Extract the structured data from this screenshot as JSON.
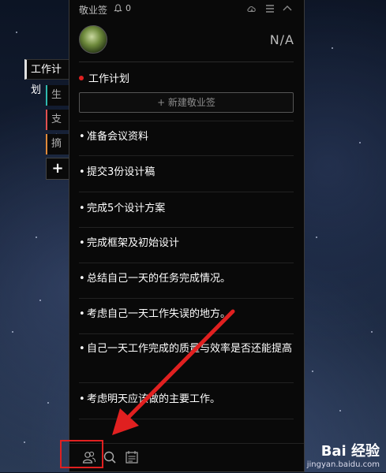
{
  "app": {
    "title": "敬业签",
    "notifications": "0"
  },
  "user": {
    "name": "N/A"
  },
  "tabs": [
    {
      "label": "工作计划",
      "color": "#e0e0e0"
    },
    {
      "label": "生活",
      "color": "#2fb8b0"
    },
    {
      "label": "支出",
      "color": "#e05050"
    },
    {
      "label": "摘抄",
      "color": "#e08a3a"
    },
    {
      "label": "+"
    }
  ],
  "list": {
    "title": "工作计划",
    "new_button": "+ 新建敬业签",
    "tasks": [
      "准备会议资料",
      "提交3份设计稿",
      "完成5个设计方案",
      "完成框架及初始设计",
      "总结自己一天的任务完成情况。",
      "考虑自己一天工作失误的地方。",
      "自己一天工作完成的质量与效率是否还能提高",
      "考虑明天应该做的主要工作。"
    ]
  },
  "bottom_icons": [
    "contacts-icon",
    "search-icon",
    "calendar-icon"
  ],
  "watermark": {
    "logo": "Bai 经验",
    "url": "jingyan.baidu.com"
  },
  "colors": {
    "panel_bg": "#090909",
    "accent_red": "#e02020"
  }
}
